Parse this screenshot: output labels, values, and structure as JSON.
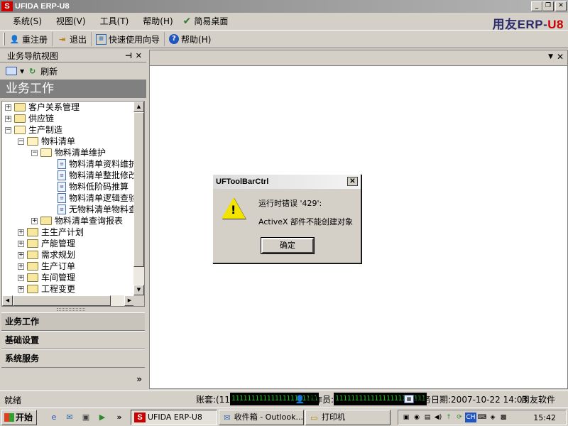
{
  "window": {
    "title": "UFIDA ERP-U8",
    "logo": "S"
  },
  "menu": {
    "items": [
      "系统(S)",
      "视图(V)",
      "工具(T)",
      "帮助(H)"
    ],
    "simple_desktop": "简易桌面"
  },
  "brand": {
    "text_main": "用友ERP-",
    "text_accent": "U8"
  },
  "toolbar": {
    "relogin": "重注册",
    "exit": "退出",
    "wizard": "快速使用向导",
    "help": "帮助(H)"
  },
  "nav": {
    "header": "业务导航视图",
    "refresh": "刷新",
    "title": "业务工作",
    "tree": [
      "客户关系管理",
      "供应链",
      "生产制造",
      "物料清单",
      "物料清单维护",
      "物料清单资料维护",
      "物料清单整批修改",
      "物料低阶码推算",
      "物料清单逻辑查验",
      "无物料清单物料查询",
      "物料清单查询报表",
      "主生产计划",
      "产能管理",
      "需求规划",
      "生产订单",
      "车间管理",
      "工程变更"
    ],
    "categories": [
      "业务工作",
      "基础设置",
      "系统服务"
    ],
    "more": "»"
  },
  "dialog": {
    "title": "UFToolBarCtrl",
    "message1": "运行时错误 '429':",
    "message2": "ActiveX 部件不能创建对象",
    "ok": "确定"
  },
  "status": {
    "ready": "就绪",
    "account_label": "账套:(11",
    "account_led": "1111111111111111111111",
    "operator_label": "操作员:",
    "operator_led": "11111111111111111111111",
    "date_label": "业务日期:2007-10-22 14:03",
    "company": "用友软件"
  },
  "taskbar": {
    "start": "开始",
    "tasks": [
      "UFIDA ERP-U8",
      "收件箱 - Outlook...",
      "打印机"
    ],
    "more": "»",
    "clock": "15:42",
    "tray_lang": "CH"
  },
  "colors": {
    "titlebar": "#808080",
    "led_fg": "#1ec81e",
    "warning": "#f2e300",
    "brand_red": "#cc0000"
  }
}
